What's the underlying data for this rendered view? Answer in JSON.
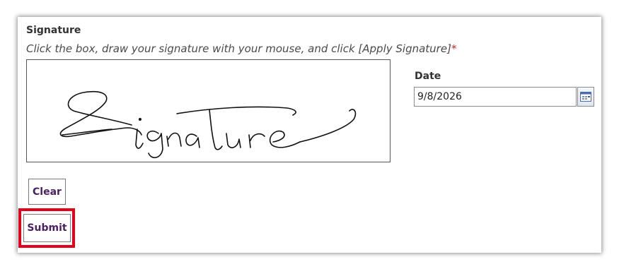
{
  "signature": {
    "title": "Signature",
    "instructions": "Click the box, draw your signature with your mouse, and click [Apply Signature]",
    "required_marker": "*",
    "drawn_text": "Signature"
  },
  "date": {
    "label": "Date",
    "value": "9/8/2026",
    "calendar_icon": "calendar-icon"
  },
  "buttons": {
    "clear_label": "Clear",
    "submit_label": "Submit"
  },
  "highlight": {
    "color": "#e3001b",
    "target": "Submit"
  },
  "colors": {
    "button_text": "#4b2163",
    "required": "#d3222a"
  }
}
